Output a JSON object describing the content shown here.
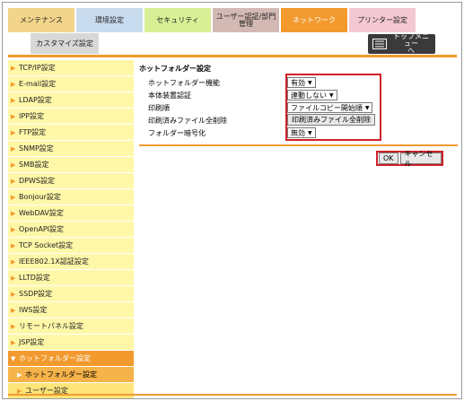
{
  "tabs": {
    "maintenance": "メンテナンス",
    "environment": "環境設定",
    "security": "セキュリティ",
    "user_auth": "ユーザー認証/部門\n管理",
    "network": "ネットワーク",
    "printer": "プリンター設定"
  },
  "subtab": {
    "customize": "カスタマイズ設定"
  },
  "top_menu": {
    "label": "トップメニュー\nへ",
    "icon": "menu-list-icon"
  },
  "sidebar": {
    "items": [
      {
        "label": "TCP/IP設定"
      },
      {
        "label": "E-mail設定"
      },
      {
        "label": "LDAP設定"
      },
      {
        "label": "IPP設定"
      },
      {
        "label": "FTP設定"
      },
      {
        "label": "SNMP設定"
      },
      {
        "label": "SMB設定"
      },
      {
        "label": "DPWS設定"
      },
      {
        "label": "Bonjour設定"
      },
      {
        "label": "WebDAV設定"
      },
      {
        "label": "OpenAPI設定"
      },
      {
        "label": "TCP Socket設定"
      },
      {
        "label": "IEEE802.1X認証設定"
      },
      {
        "label": "LLTD設定"
      },
      {
        "label": "SSDP設定"
      },
      {
        "label": "IWS設定"
      },
      {
        "label": "リモートパネル設定"
      },
      {
        "label": "JSP設定"
      },
      {
        "label": "ホットフォルダー設定"
      }
    ],
    "subitems": [
      {
        "label": "ホットフォルダー設定"
      },
      {
        "label": "ユーザー設定"
      }
    ]
  },
  "main": {
    "title": "ホットフォルダー設定",
    "rows": [
      {
        "label": "ホットフォルダー機能",
        "value": "有効"
      },
      {
        "label": "本体装置認証",
        "value": "連動しない"
      },
      {
        "label": "印刷順",
        "value": "ファイルコピー開始順"
      },
      {
        "label": "印刷済みファイル全削除",
        "button": "印刷済みファイル全削除"
      },
      {
        "label": "フォルダー暗号化",
        "value": "無効"
      }
    ],
    "ok_label": "OK",
    "cancel_label": "キャンセル"
  },
  "colors": {
    "accent": "#f29a2e",
    "sidebar_bg": "#fff7a8",
    "highlight_box": "#d0202a"
  }
}
